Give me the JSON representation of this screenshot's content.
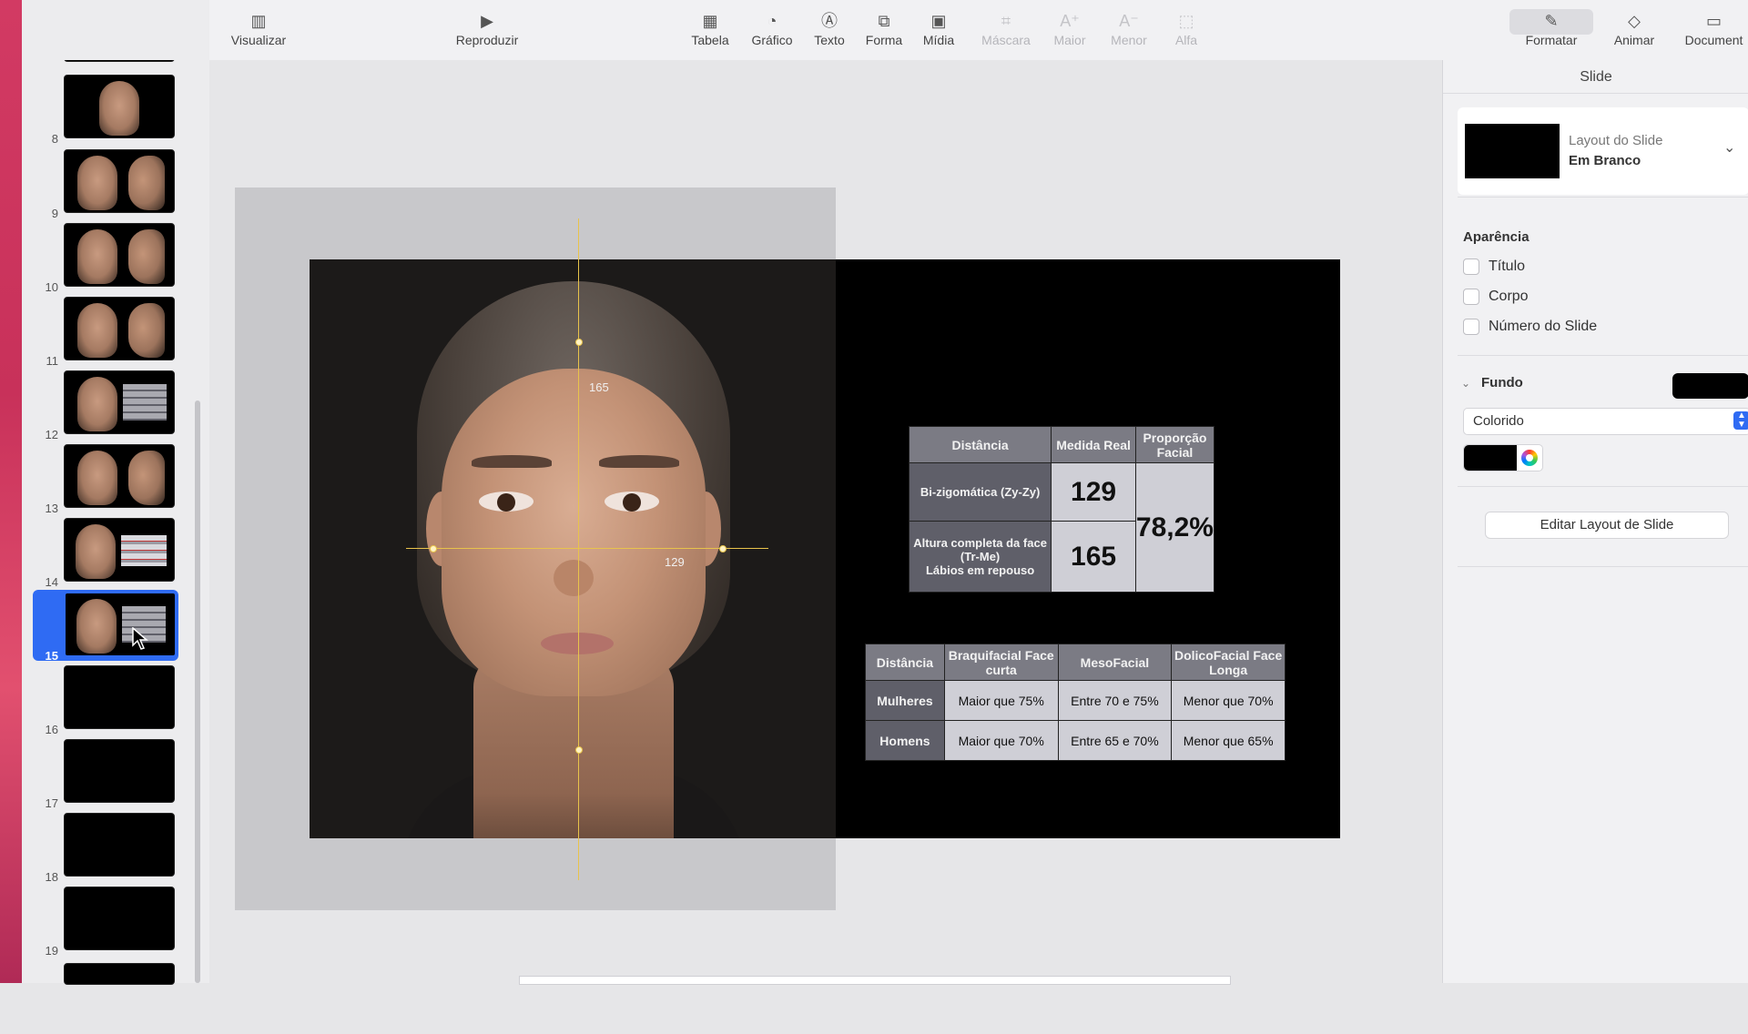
{
  "toolbar": {
    "visualizar": "Visualizar",
    "reproduzir": "Reproduzir",
    "tabela": "Tabela",
    "grafico": "Gráfico",
    "texto": "Texto",
    "forma": "Forma",
    "midia": "Mídia",
    "mascara": "Máscara",
    "maior": "Maior",
    "menor": "Menor",
    "alfa": "Alfa",
    "formatar": "Formatar",
    "animar": "Animar",
    "documento": "Document"
  },
  "navigator": {
    "slide_numbers": [
      "8",
      "9",
      "10",
      "11",
      "12",
      "13",
      "14",
      "15",
      "16",
      "17",
      "18",
      "19"
    ],
    "selected": "15"
  },
  "slide": {
    "guides": {
      "vertical_label": "165",
      "horizontal_label": "129"
    },
    "table1": {
      "headers": [
        "Distância",
        "Medida Real",
        "Proporção Facial"
      ],
      "row1_label": "Bi-zigomática (Zy-Zy)",
      "row1_value": "129",
      "row2_label_line1": "Altura completa da face",
      "row2_label_line2": "(Tr-Me)",
      "row2_label_line3": "Lábios em repouso",
      "row2_value": "165",
      "proportion": "78,2%"
    },
    "table2": {
      "headers": [
        "Distância",
        "Braquifacial Face curta",
        "MesoFacial",
        "DolicoFacial Face Longa"
      ],
      "rows": [
        [
          "Mulheres",
          "Maior que 75%",
          "Entre 70 e 75%",
          "Menor que 70%"
        ],
        [
          "Homens",
          "Maior que 70%",
          "Entre 65 e 70%",
          "Menor que 65%"
        ]
      ]
    }
  },
  "inspector": {
    "title": "Slide",
    "layout_label": "Layout do Slide",
    "layout_value": "Em Branco",
    "appearance_title": "Aparência",
    "chk_titulo": "Título",
    "chk_corpo": "Corpo",
    "chk_numero": "Número do Slide",
    "fundo_title": "Fundo",
    "fill_type": "Colorido",
    "edit_layout": "Editar Layout de Slide"
  }
}
